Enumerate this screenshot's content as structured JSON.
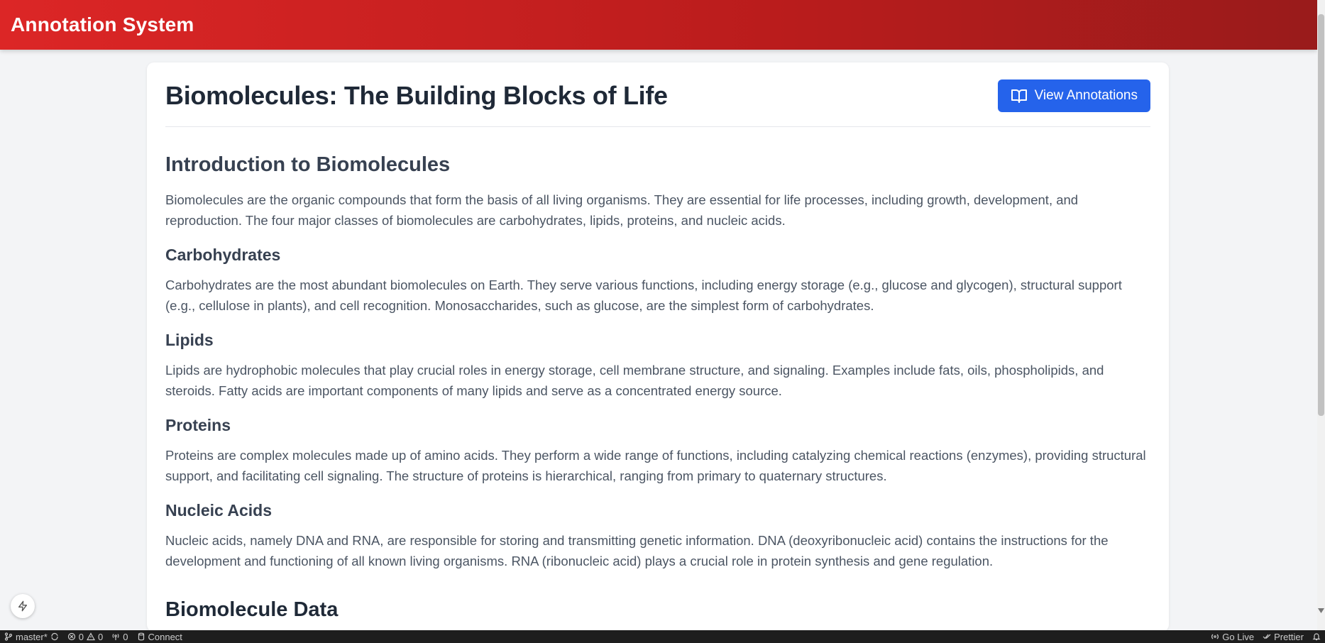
{
  "header": {
    "title": "Annotation System"
  },
  "page": {
    "title": "Biomolecules: The Building Blocks of Life",
    "view_annotations_label": "View Annotations"
  },
  "intro": {
    "heading": "Introduction to Biomolecules",
    "text": "Biomolecules are the organic compounds that form the basis of all living organisms. They are essential for life processes, including growth, development, and reproduction. The four major classes of biomolecules are carbohydrates, lipids, proteins, and nucleic acids."
  },
  "sections": [
    {
      "heading": "Carbohydrates",
      "text": "Carbohydrates are the most abundant biomolecules on Earth. They serve various functions, including energy storage (e.g., glucose and glycogen), structural support (e.g., cellulose in plants), and cell recognition. Monosaccharides, such as glucose, are the simplest form of carbohydrates."
    },
    {
      "heading": "Lipids",
      "text": "Lipids are hydrophobic molecules that play crucial roles in energy storage, cell membrane structure, and signaling. Examples include fats, oils, phospholipids, and steroids. Fatty acids are important components of many lipids and serve as a concentrated energy source."
    },
    {
      "heading": "Proteins",
      "text": "Proteins are complex molecules made up of amino acids. They perform a wide range of functions, including catalyzing chemical reactions (enzymes), providing structural support, and facilitating cell signaling. The structure of proteins is hierarchical, ranging from primary to quaternary structures."
    },
    {
      "heading": "Nucleic Acids",
      "text": "Nucleic acids, namely DNA and RNA, are responsible for storing and transmitting genetic information. DNA (deoxyribonucleic acid) contains the instructions for the development and functioning of all known living organisms. RNA (ribonucleic acid) plays a crucial role in protein synthesis and gene regulation."
    }
  ],
  "data_section": {
    "heading": "Biomolecule Data"
  },
  "statusbar": {
    "branch": "master*",
    "errors": "0",
    "warnings": "0",
    "ports": "0",
    "connect": "Connect",
    "go_live": "Go Live",
    "prettier": "Prettier"
  },
  "colors": {
    "header_start": "#dc2626",
    "header_end": "#991b1b",
    "button": "#2563eb"
  },
  "icons": {
    "view_annotations": "book-open-icon",
    "fab": "lightning-icon"
  }
}
